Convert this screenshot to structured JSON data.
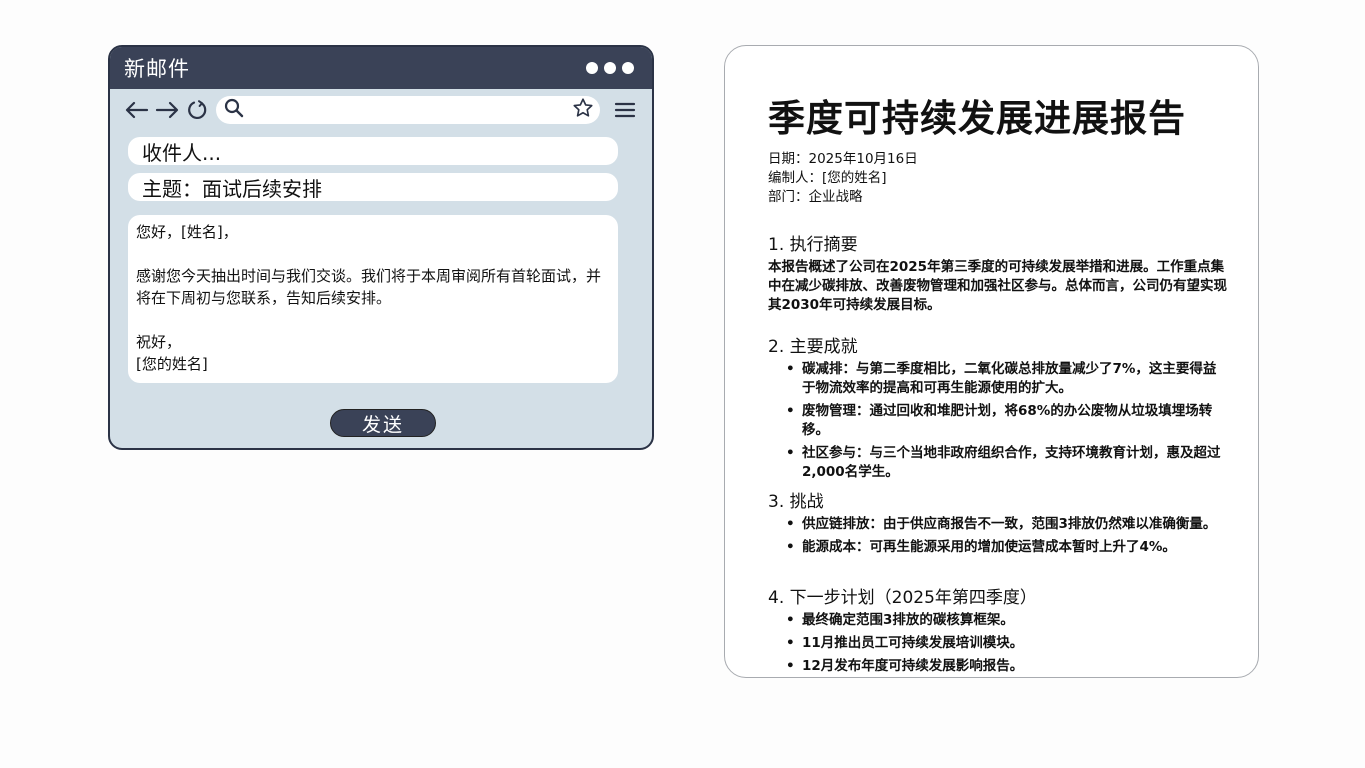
{
  "mail": {
    "window_title": "新邮件",
    "to_placeholder": "收件人...",
    "subject": "主题：面试后续安排",
    "body": {
      "greeting": "您好，[姓名]，",
      "paragraph": "感谢您今天抽出时间与我们交谈。我们将于本周审阅所有首轮面试，并将在下周初与您联系，告知后续安排。",
      "closing": "祝好，",
      "signature": "[您的姓名]"
    },
    "send_label": "发送"
  },
  "report": {
    "title": "季度可持续发展进展报告",
    "date": "日期：2025年10月16日",
    "author": "编制人：[您的姓名]",
    "department": "部门：企业战略",
    "sections": [
      {
        "heading": "1. 执行摘要",
        "text": "本报告概述了公司在2025年第三季度的可持续发展举措和进展。工作重点集中在减少碳排放、改善废物管理和加强社区参与。总体而言，公司仍有望实现其2030年可持续发展目标。"
      },
      {
        "heading": "2. 主要成就",
        "items": [
          "碳减排：与第二季度相比，二氧化碳总排放量减少了7%，这主要得益于物流效率的提高和可再生能源使用的扩大。",
          "废物管理：通过回收和堆肥计划，将68%的办公废物从垃圾填埋场转移。",
          "社区参与：与三个当地非政府组织合作，支持环境教育计划，惠及超过2,000名学生。"
        ]
      },
      {
        "heading": "3. 挑战",
        "items": [
          "供应链排放：由于供应商报告不一致，范围3排放仍然难以准确衡量。",
          "能源成本：可再生能源采用的增加使运营成本暂时上升了4%。"
        ]
      },
      {
        "heading": "4. 下一步计划（2025年第四季度）",
        "items": [
          "最终确定范围3排放的碳核算框架。",
          "11月推出员工可持续发展培训模块。",
          "12月发布年度可持续发展影响报告。"
        ]
      }
    ]
  }
}
